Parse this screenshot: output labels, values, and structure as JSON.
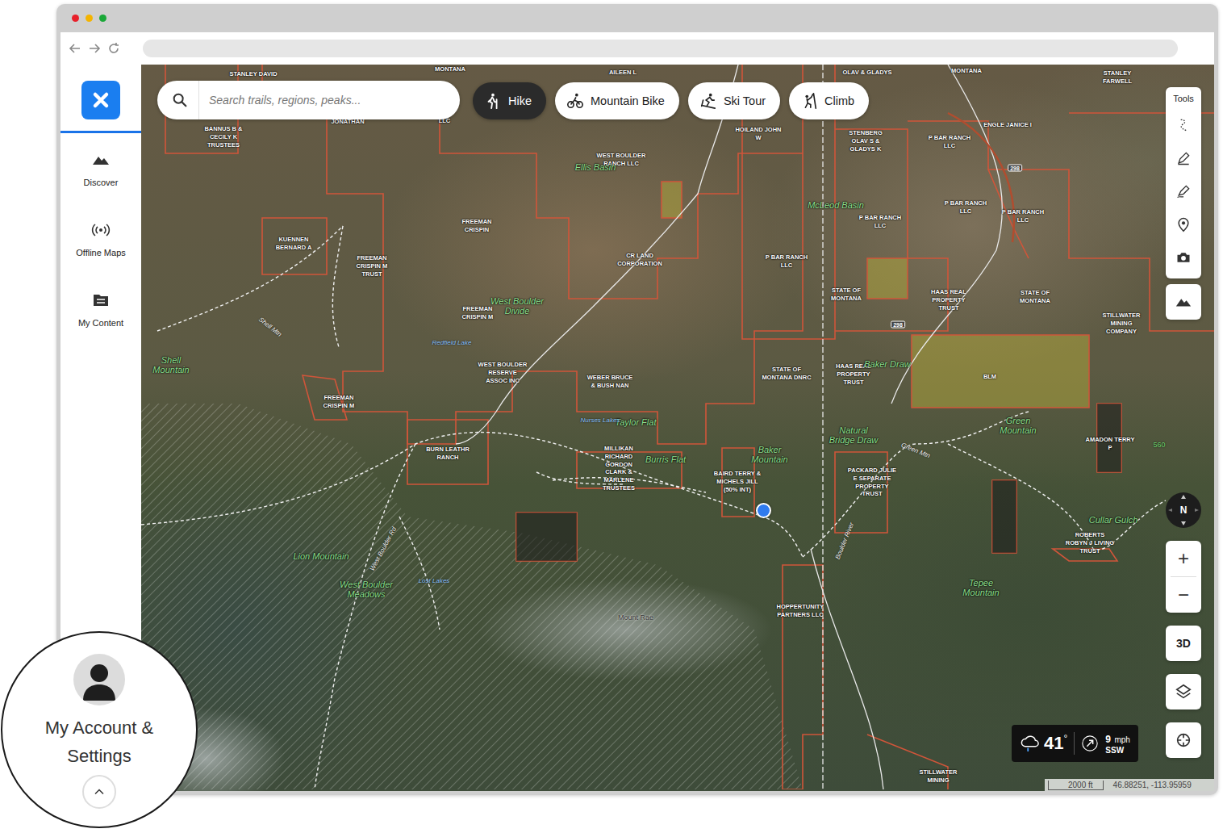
{
  "search": {
    "placeholder": "Search trails, regions, peaks..."
  },
  "activities": [
    {
      "label": "Hike",
      "selected": true,
      "kind": "hike"
    },
    {
      "label": "Mountain Bike",
      "selected": false,
      "kind": "bike"
    },
    {
      "label": "Ski Tour",
      "selected": false,
      "kind": "ski"
    },
    {
      "label": "Climb",
      "selected": false,
      "kind": "climb"
    }
  ],
  "sidebar": {
    "items": [
      {
        "label": "Discover",
        "kind": "discover"
      },
      {
        "label": "Offline Maps",
        "kind": "offline"
      },
      {
        "label": "My Content",
        "kind": "content"
      }
    ]
  },
  "tools": {
    "title": "Tools"
  },
  "compass": {
    "label": "N"
  },
  "zoom": {
    "in": "+",
    "out": "−"
  },
  "view_3d": "3D",
  "weather": {
    "temperature": "41",
    "degree": "°",
    "wind_speed": "9",
    "wind_unit": "mph",
    "wind_direction": "SSW"
  },
  "scale": {
    "label": "2000 ft",
    "coordinates": "46.88251, -113.95959"
  },
  "account": {
    "label": "My Account & Settings"
  },
  "map_labels": [
    {
      "text": "STANLEY DAVID",
      "kind": "owner"
    },
    {
      "text": "MONTANA",
      "kind": "owner"
    },
    {
      "text": "AILEEN L",
      "kind": "owner"
    },
    {
      "text": "OLAV & GLADYS",
      "kind": "owner"
    },
    {
      "text": "MONTANA",
      "kind": "owner"
    },
    {
      "text": "STANLEY FARWELL",
      "kind": "owner"
    },
    {
      "text": "BANNUS B & CECILY K TRUSTEES",
      "kind": "owner"
    },
    {
      "text": "JONATHAN",
      "kind": "owner"
    },
    {
      "text": "LLC",
      "kind": "owner"
    },
    {
      "text": "HOILAND JOHN W",
      "kind": "owner"
    },
    {
      "text": "STENBERG OLAV S & GLADYS K",
      "kind": "owner"
    },
    {
      "text": "P BAR RANCH LLC",
      "kind": "owner"
    },
    {
      "text": "ENGLE JANICE I",
      "kind": "owner"
    },
    {
      "text": "WEST BOULDER RANCH LLC",
      "kind": "owner"
    },
    {
      "text": "Ellis Basin",
      "kind": "place"
    },
    {
      "text": "McLeod Basin",
      "kind": "place"
    },
    {
      "text": "P BAR RANCH LLC",
      "kind": "owner"
    },
    {
      "text": "P BAR RANCH LLC",
      "kind": "owner"
    },
    {
      "text": "P BAR RANCH LLC",
      "kind": "owner"
    },
    {
      "text": "KUENNEN BERNARD A",
      "kind": "owner"
    },
    {
      "text": "FREEMAN CRISPIN",
      "kind": "owner"
    },
    {
      "text": "FREEMAN CRISPIN M TRUST",
      "kind": "owner"
    },
    {
      "text": "CR LAND CORPORATION",
      "kind": "owner"
    },
    {
      "text": "P BAR RANCH LLC",
      "kind": "owner"
    },
    {
      "text": "STATE OF MONTANA",
      "kind": "owner"
    },
    {
      "text": "HAAS REAL PROPERTY TRUST",
      "kind": "owner"
    },
    {
      "text": "STATE OF MONTANA",
      "kind": "owner"
    },
    {
      "text": "STILLWATER MINING COMPANY",
      "kind": "owner"
    },
    {
      "text": "FREEMAN CRISPIN M",
      "kind": "owner"
    },
    {
      "text": "West Boulder Divide",
      "kind": "place"
    },
    {
      "text": "Redfield Lake",
      "kind": "water"
    },
    {
      "text": "Shell Mountain",
      "kind": "place"
    },
    {
      "text": "WEST BOULDER RESERVE ASSOC INC",
      "kind": "owner"
    },
    {
      "text": "WEBER BRUCE & BUSH NAN",
      "kind": "owner"
    },
    {
      "text": "STATE OF MONTANA DNRC",
      "kind": "owner"
    },
    {
      "text": "HAAS REAL PROPERTY TRUST",
      "kind": "owner"
    },
    {
      "text": "Baker Draw",
      "kind": "place"
    },
    {
      "text": "BLM",
      "kind": "owner"
    },
    {
      "text": "FREEMAN CRISPIN M",
      "kind": "owner"
    },
    {
      "text": "Green Mountain",
      "kind": "place"
    },
    {
      "text": "Taylor Flat",
      "kind": "place"
    },
    {
      "text": "Nurses Lakes",
      "kind": "water"
    },
    {
      "text": "Natural Bridge Draw",
      "kind": "place"
    },
    {
      "text": "BURN LEATHR RANCH",
      "kind": "owner"
    },
    {
      "text": "MILLIKAN RICHARD GORDON CLARK & MARLENE TRUSTEES",
      "kind": "owner"
    },
    {
      "text": "Burris Flat",
      "kind": "place"
    },
    {
      "text": "BAIRD TERRY & MICHELS JILL (50% INT)",
      "kind": "owner"
    },
    {
      "text": "Baker Mountain",
      "kind": "place"
    },
    {
      "text": "PACKARD JULIE E SEPARATE PROPERTY TRUST",
      "kind": "owner"
    },
    {
      "text": "AMADON TERRY P",
      "kind": "owner"
    },
    {
      "text": "560",
      "kind": "elevation"
    },
    {
      "text": "Cullar Gulch",
      "kind": "place"
    },
    {
      "text": "ROBERTS ROBYN J LIVING TRUST",
      "kind": "owner"
    },
    {
      "text": "Lion Mountain",
      "kind": "place"
    },
    {
      "text": "West Boulder Meadows",
      "kind": "place"
    },
    {
      "text": "Lost Lakes",
      "kind": "water"
    },
    {
      "text": "Tepee Mountain",
      "kind": "place"
    },
    {
      "text": "Mount Rae",
      "kind": "peak"
    },
    {
      "text": "HOPPERTUNITY PARTNERS LLC",
      "kind": "owner"
    },
    {
      "text": "STILLWATER MINING",
      "kind": "owner"
    },
    {
      "text": "Shell Mtn",
      "kind": "road"
    },
    {
      "text": "West Boulder Rd",
      "kind": "road"
    },
    {
      "text": "Green Mtn",
      "kind": "road"
    },
    {
      "text": "Boulder River",
      "kind": "road"
    },
    {
      "text": "298",
      "kind": "shield"
    },
    {
      "text": "298",
      "kind": "shield"
    }
  ]
}
